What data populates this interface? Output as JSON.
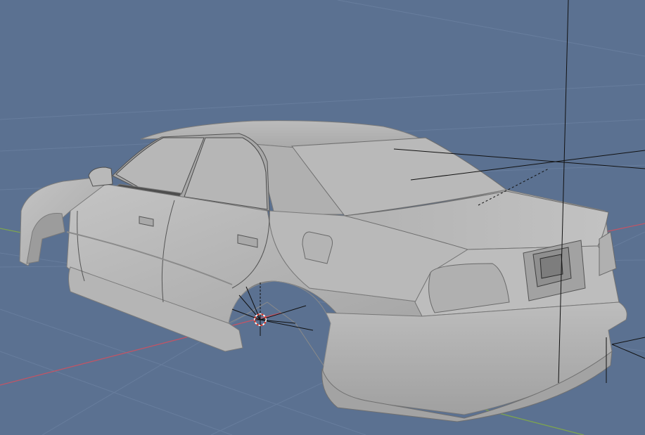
{
  "viewport": {
    "shading_mode": "solid",
    "view": "perspective",
    "colors": {
      "background": "#5b7191",
      "grid_line": "#6a7e9c",
      "axis_x": "#c05566",
      "axis_y": "#7da44f",
      "mesh_fill": "#b3b3b3",
      "mesh_shadow": "#8e8e8e",
      "mesh_highlight": "#c8c8c8",
      "helper_line": "#111111",
      "cursor_ring_red": "#e63a2a",
      "cursor_ring_white": "#ffffff"
    }
  },
  "scene": {
    "object": {
      "name_icon": "car-body-mesh",
      "parts": [
        "body-shell",
        "front-fender",
        "rear-door",
        "front-door",
        "side-mirror",
        "trunk-lid",
        "tail-light",
        "license-plate-recess",
        "rear-bumper",
        "side-skirt",
        "fuel-door"
      ]
    },
    "empties": [
      "light-helper",
      "camera-helper"
    ],
    "cursor_icon": "3d-cursor-icon"
  }
}
